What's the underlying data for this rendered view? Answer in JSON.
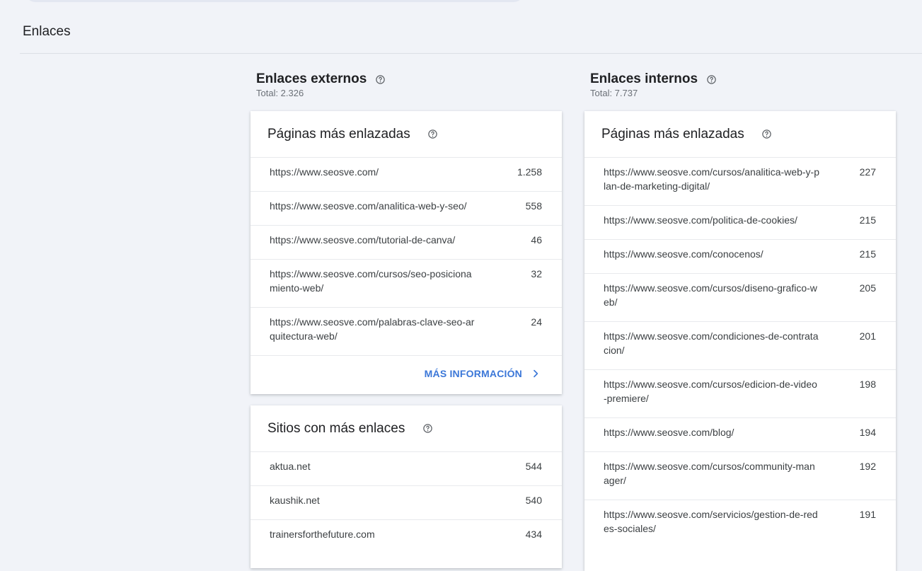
{
  "page": {
    "title": "Enlaces"
  },
  "external_links": {
    "heading": "Enlaces externos",
    "total": "Total: 2.326",
    "top_pages": {
      "title": "Páginas más enlazadas",
      "rows": [
        {
          "url": "https://www.seosve.com/",
          "count": "1.258"
        },
        {
          "url": "https://www.seosve.com/analitica-web-y-seo/",
          "count": "558"
        },
        {
          "url": "https://www.seosve.com/tutorial-de-canva/",
          "count": "46"
        },
        {
          "url": "https://www.seosve.com/cursos/seo-posicionamiento-web/",
          "count": "32"
        },
        {
          "url": "https://www.seosve.com/palabras-clave-seo-arquitectura-web/",
          "count": "24"
        }
      ],
      "more_label": "MÁS INFORMACIÓN"
    },
    "top_sites": {
      "title": "Sitios con más enlaces",
      "rows": [
        {
          "site": "aktua.net",
          "count": "544"
        },
        {
          "site": "kaushik.net",
          "count": "540"
        },
        {
          "site": "trainersforthefuture.com",
          "count": "434"
        }
      ]
    }
  },
  "internal_links": {
    "heading": "Enlaces internos",
    "total": "Total: 7.737",
    "top_pages": {
      "title": "Páginas más enlazadas",
      "rows": [
        {
          "url": "https://www.seosve.com/cursos/analitica-web-y-plan-de-marketing-digital/",
          "count": "227"
        },
        {
          "url": "https://www.seosve.com/politica-de-cookies/",
          "count": "215"
        },
        {
          "url": "https://www.seosve.com/conocenos/",
          "count": "215"
        },
        {
          "url": "https://www.seosve.com/cursos/diseno-grafico-web/",
          "count": "205"
        },
        {
          "url": "https://www.seosve.com/condiciones-de-contratacion/",
          "count": "201"
        },
        {
          "url": "https://www.seosve.com/cursos/edicion-de-video-premiere/",
          "count": "198"
        },
        {
          "url": "https://www.seosve.com/blog/",
          "count": "194"
        },
        {
          "url": "https://www.seosve.com/cursos/community-manager/",
          "count": "192"
        },
        {
          "url": "https://www.seosve.com/servicios/gestion-de-redes-sociales/",
          "count": "191"
        }
      ]
    }
  },
  "icons": {
    "help": "help-circle-icon",
    "chevron": "chevron-right-icon"
  },
  "colors": {
    "accent": "#3b77d8",
    "background": "#f1f3f8",
    "text": "#202124",
    "secondary_text": "#6b7077"
  }
}
